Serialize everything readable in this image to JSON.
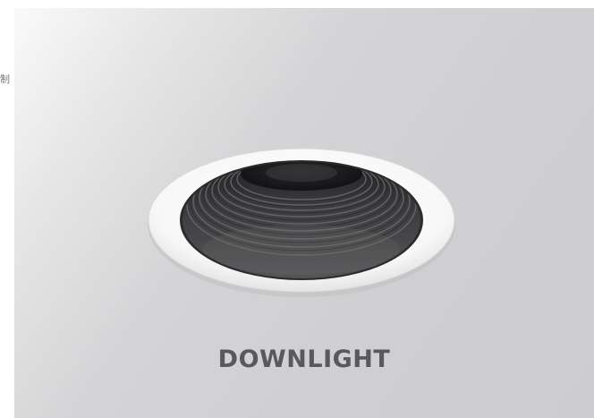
{
  "side_text": "制",
  "banner": {
    "title": "DOWNLIGHT",
    "image": {
      "icon": "recessed-downlight-fixture",
      "colors": {
        "trim": "#ffffff",
        "baffle": "#3f3f41",
        "background": "#cfcfd1",
        "title_text": "#58595b"
      }
    }
  }
}
